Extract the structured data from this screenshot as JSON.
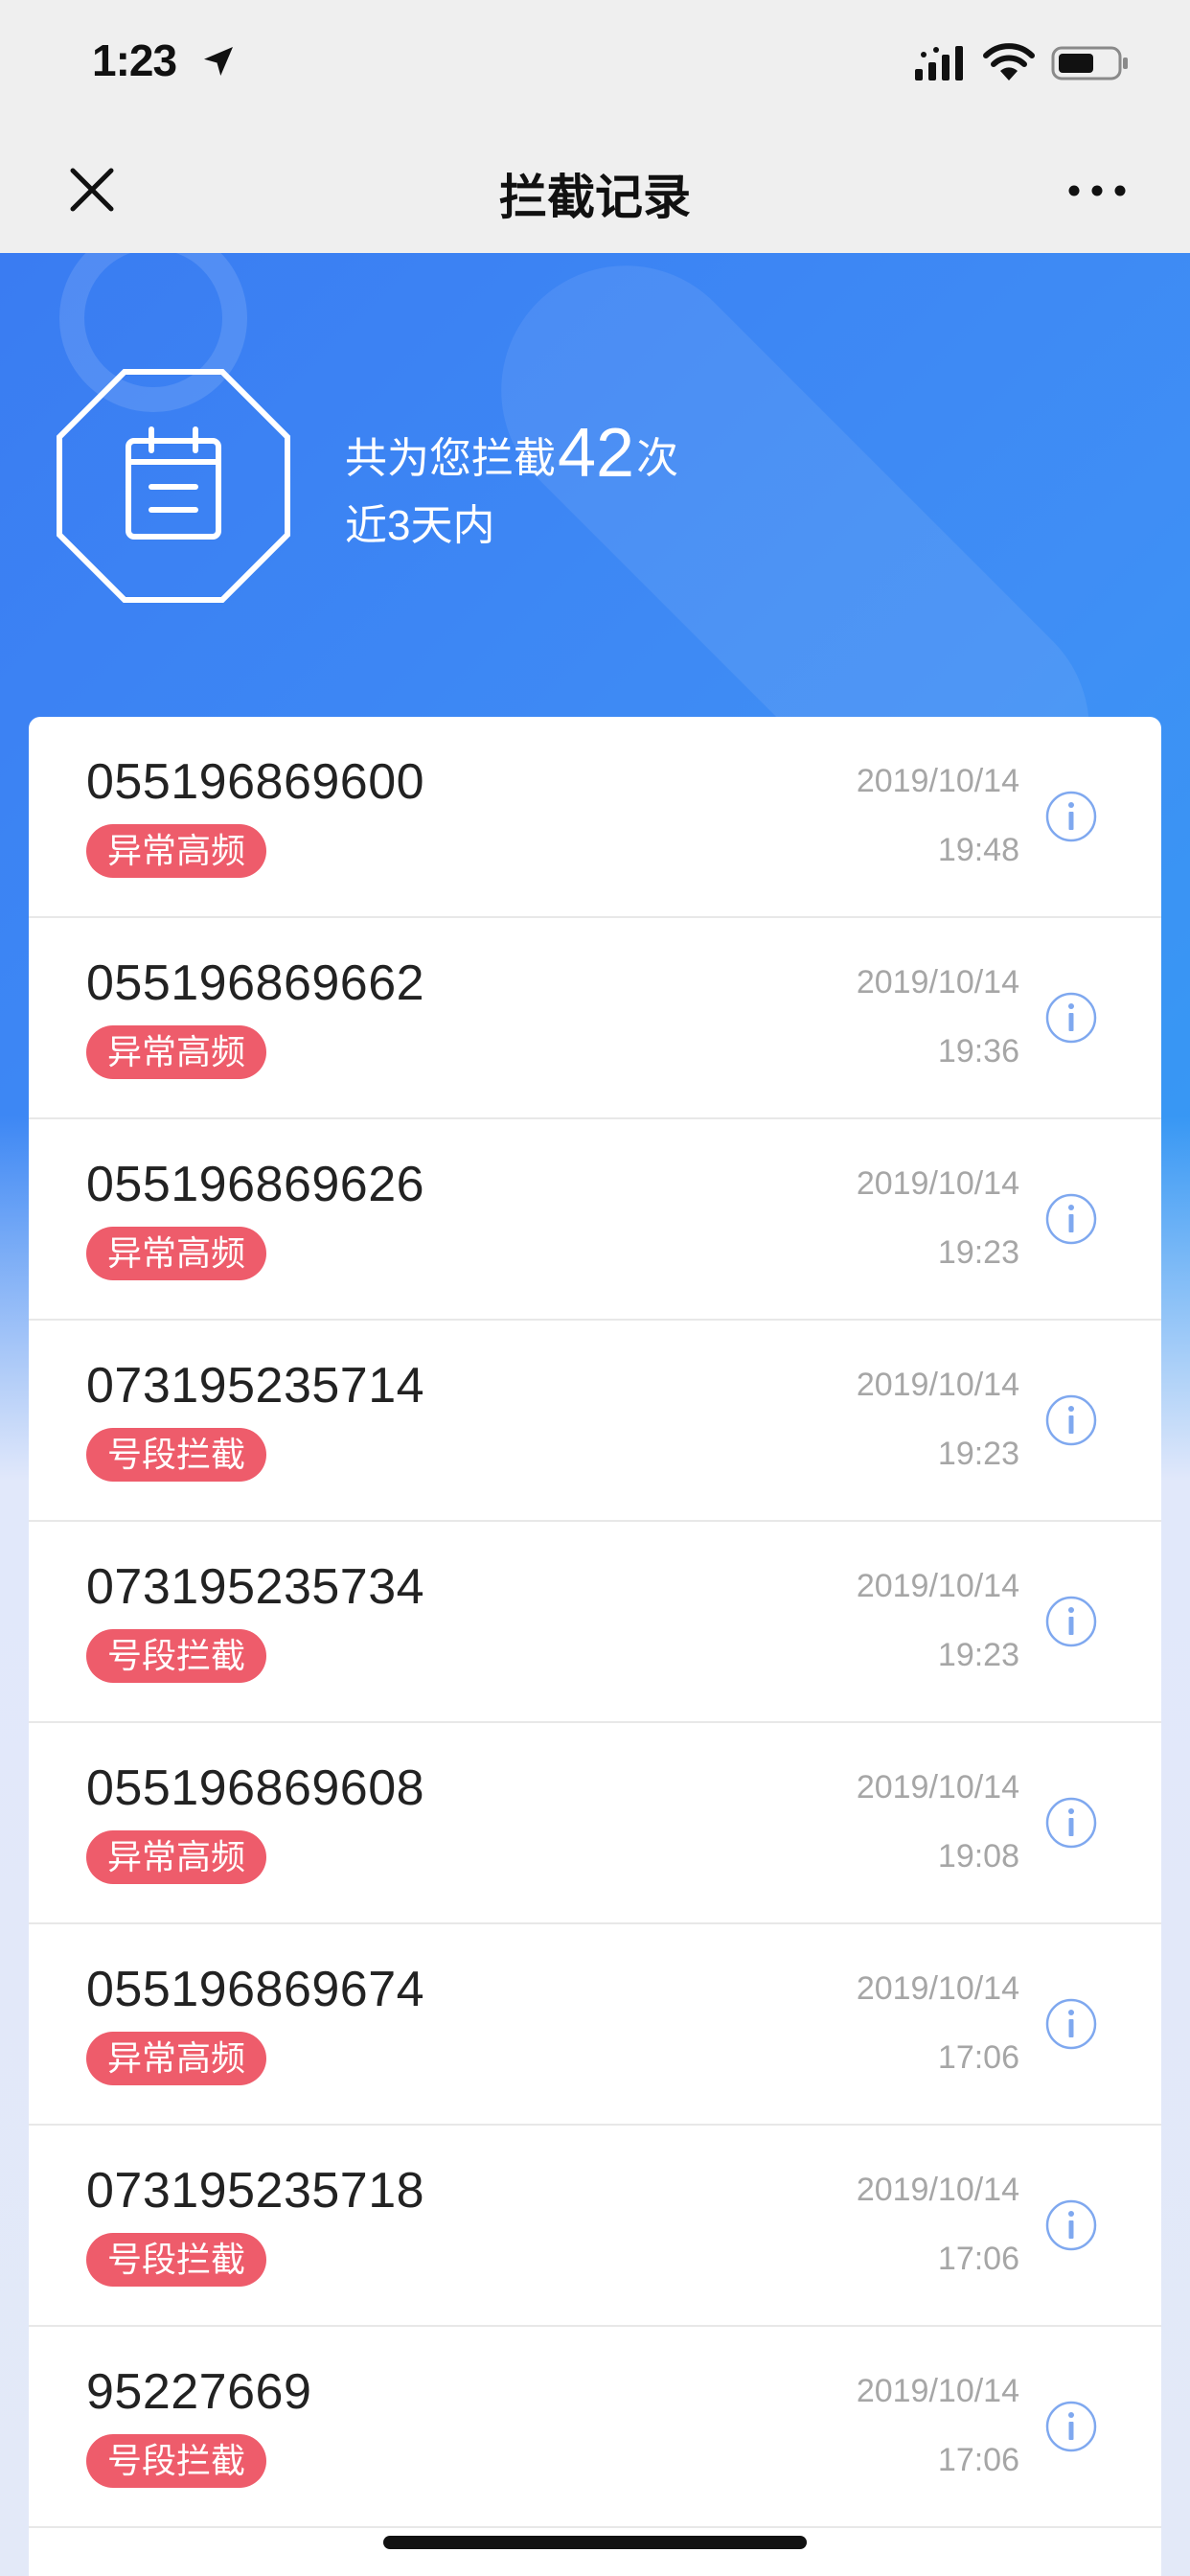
{
  "status_bar": {
    "time": "1:23"
  },
  "nav": {
    "title": "拦截记录"
  },
  "summary": {
    "prefix": "共为您拦截",
    "count": "42",
    "suffix": "次",
    "subtitle": "近3天内"
  },
  "records": [
    {
      "number": "055196869600",
      "tag": "异常高频",
      "date": "2019/10/14",
      "time": "19:48"
    },
    {
      "number": "055196869662",
      "tag": "异常高频",
      "date": "2019/10/14",
      "time": "19:36"
    },
    {
      "number": "055196869626",
      "tag": "异常高频",
      "date": "2019/10/14",
      "time": "19:23"
    },
    {
      "number": "073195235714",
      "tag": "号段拦截",
      "date": "2019/10/14",
      "time": "19:23"
    },
    {
      "number": "073195235734",
      "tag": "号段拦截",
      "date": "2019/10/14",
      "time": "19:23"
    },
    {
      "number": "055196869608",
      "tag": "异常高频",
      "date": "2019/10/14",
      "time": "19:08"
    },
    {
      "number": "055196869674",
      "tag": "异常高频",
      "date": "2019/10/14",
      "time": "17:06"
    },
    {
      "number": "073195235718",
      "tag": "号段拦截",
      "date": "2019/10/14",
      "time": "17:06"
    },
    {
      "number": "95227669",
      "tag": "号段拦截",
      "date": "2019/10/14",
      "time": "17:06"
    }
  ],
  "colors": {
    "tag_red": "#ee5c6b",
    "banner_blue": "#3a7cf2",
    "info_blue": "#7fa8ef"
  }
}
